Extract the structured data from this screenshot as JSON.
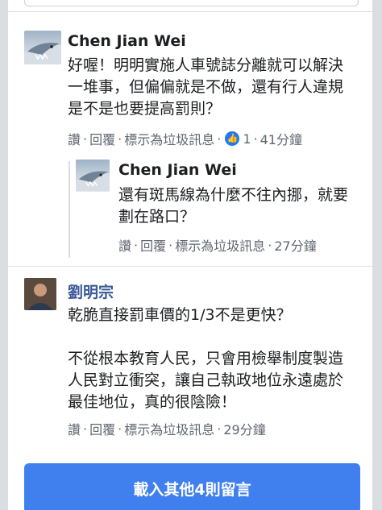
{
  "comments": [
    {
      "author": "Chen Jian Wei",
      "text": "好喔！明明實施人車號誌分離就可以解決\n一堆事，但偏偏就是不做，還有行人違規\n是不是也要提高罰則？",
      "actions": {
        "like": "讚",
        "reply": "回覆",
        "spam": "標示為垃圾訊息",
        "reaction_count": "1",
        "time": "41分鐘"
      },
      "reply": {
        "author": "Chen Jian Wei",
        "text": "還有斑馬線為什麼不往內挪，就要\n劃在路口？",
        "actions": {
          "like": "讚",
          "reply": "回覆",
          "spam": "標示為垃圾訊息",
          "time": "27分鐘"
        }
      }
    },
    {
      "author": "劉明宗",
      "text": "乾脆直接罰車價的1/3不是更快？\n\n不從根本教育人民，只會用檢舉制度製造\n人民對立衝突，讓自己執政地位永遠處於\n最佳地位，真的很陰險！",
      "actions": {
        "like": "讚",
        "reply": "回覆",
        "spam": "標示為垃圾訊息",
        "time": "29分鐘"
      }
    }
  ],
  "load_more_label": "載入其他4則留言",
  "colors": {
    "accent": "#4080ee",
    "like_badge": "#2078f4",
    "link_gray": "#606770",
    "name_blue": "#3b5998"
  }
}
